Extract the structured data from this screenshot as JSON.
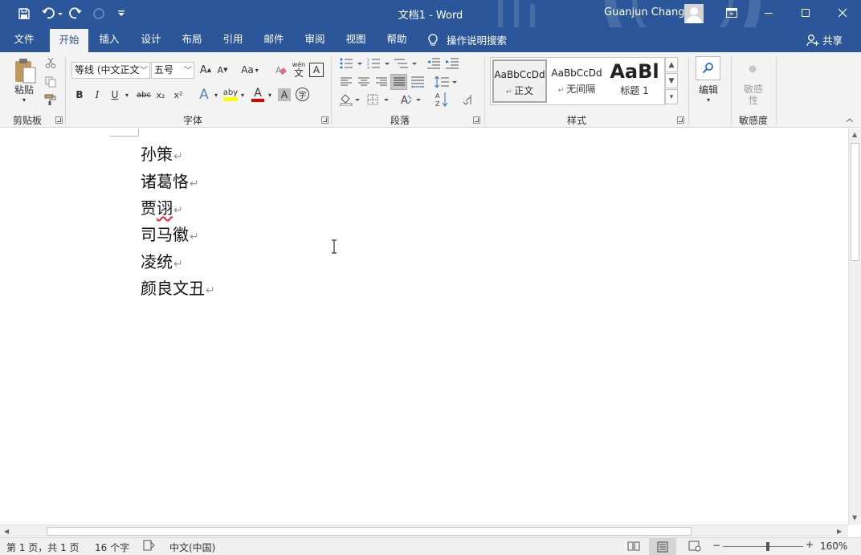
{
  "window": {
    "title": "文档1  -  Word",
    "user_name": "Guanjun Chang",
    "colors": {
      "title_bar": "#2b579a",
      "ribbon": "#f3f3f3"
    }
  },
  "tabs": [
    {
      "label": "文件",
      "active": false
    },
    {
      "label": "开始",
      "active": true
    },
    {
      "label": "插入",
      "active": false
    },
    {
      "label": "设计",
      "active": false
    },
    {
      "label": "布局",
      "active": false
    },
    {
      "label": "引用",
      "active": false
    },
    {
      "label": "邮件",
      "active": false
    },
    {
      "label": "审阅",
      "active": false
    },
    {
      "label": "视图",
      "active": false
    },
    {
      "label": "帮助",
      "active": false
    }
  ],
  "tell_me": "操作说明搜索",
  "share_label": "共享",
  "ribbon": {
    "clipboard": {
      "group_label": "剪贴板",
      "paste_label": "粘贴"
    },
    "font": {
      "group_label": "字体",
      "font_name": "等线 (中文正文",
      "font_size": "五号",
      "case_label": "Aa",
      "phonetic_label": "wén",
      "bold": "B",
      "italic": "I",
      "underline": "U",
      "strike": "abc",
      "sub": "x₂",
      "sup": "x²",
      "highlight_label": "aby",
      "text_effects": "A",
      "font_color": "A",
      "char_shading": "A",
      "enclose_char": "字",
      "grow_font": "A",
      "shrink_font": "A"
    },
    "paragraph": {
      "group_label": "段落"
    },
    "styles": {
      "group_label": "样式",
      "items": [
        {
          "sample": "AaBbCcDd",
          "name": "正文",
          "selected": true
        },
        {
          "sample": "AaBbCcDd",
          "name": "无间隔",
          "selected": false
        },
        {
          "sample": "AaBl",
          "name": "标题 1",
          "selected": false
        }
      ]
    },
    "editing": {
      "label": "编辑"
    },
    "sensitivity": {
      "group_label": "敏感度",
      "button_label": "敏感\n性"
    }
  },
  "document": {
    "lines": [
      {
        "text": "孙策",
        "misspelled": false
      },
      {
        "text": "诸葛恪",
        "misspelled": false
      },
      {
        "text": "贾诩",
        "misspelled": true
      },
      {
        "text": "司马徽",
        "misspelled": false
      },
      {
        "text": "凌统",
        "misspelled": false
      },
      {
        "text": "颜良文丑",
        "misspelled": false
      }
    ],
    "paragraph_mark": "↵"
  },
  "status_bar": {
    "page": "第 1 页，共 1 页",
    "words": "16 个字",
    "language": "中文(中国)",
    "zoom": "160%",
    "zoom_minus": "−",
    "zoom_plus": "+"
  }
}
